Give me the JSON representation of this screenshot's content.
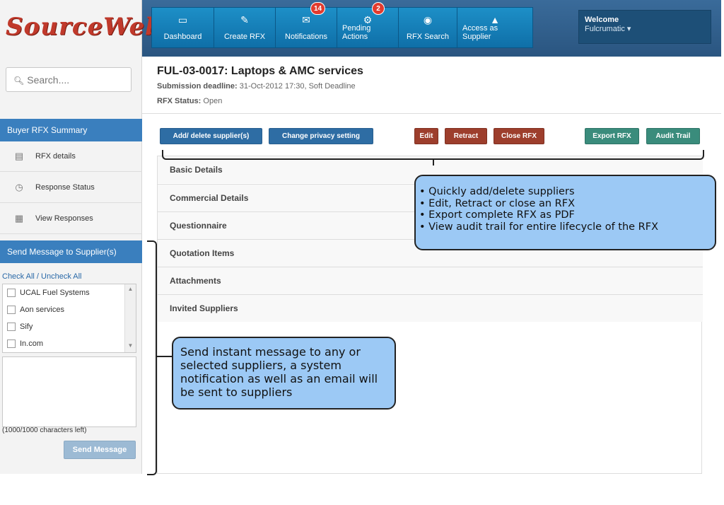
{
  "header": {
    "logo": "SourceWeb",
    "nav": [
      {
        "label": "Dashboard",
        "icon": "monitor-icon",
        "glyph": "▭"
      },
      {
        "label": "Create RFX",
        "icon": "edit-icon",
        "glyph": "✎"
      },
      {
        "label": "Notifications",
        "icon": "envelope-icon",
        "glyph": "✉",
        "badge": "14"
      },
      {
        "label": "Pending Actions",
        "icon": "gear-icon",
        "glyph": "⚙",
        "badge": "2"
      },
      {
        "label": "RFX Search",
        "icon": "search-circle-icon",
        "glyph": "◉"
      },
      {
        "label": "Access as Supplier",
        "icon": "supplier-icon",
        "glyph": "▲"
      }
    ],
    "welcome": "Welcome",
    "user": "Fulcrumatic ▾"
  },
  "sidebar": {
    "search_placeholder": "Search....",
    "summary_title": "Buyer RFX Summary",
    "items": [
      {
        "label": "RFX details",
        "icon": "list-icon"
      },
      {
        "label": "Response Status",
        "icon": "clock-icon"
      },
      {
        "label": "View Responses",
        "icon": "responses-icon"
      }
    ],
    "message_title": "Send Message to Supplier(s)",
    "check_all": "Check All / Uncheck All",
    "suppliers": [
      "UCAL Fuel Systems",
      "Aon services",
      "Sify",
      "In.com"
    ],
    "chars_left": "(1000/1000 characters left)",
    "send_button": "Send Message"
  },
  "main": {
    "title": "FUL-03-0017: Laptops & AMC services",
    "deadline_label": "Submission deadline:",
    "deadline_value": "31-Oct-2012 17:30, Soft Deadline",
    "status_label": "RFX Status:",
    "status_value": "Open",
    "buttons": {
      "add_delete": "Add/ delete supplier(s)",
      "privacy": "Change privacy setting",
      "edit": "Edit",
      "retract": "Retract",
      "close": "Close RFX",
      "export": "Export RFX",
      "audit": "Audit Trail"
    },
    "sections": [
      "Basic Details",
      "Commercial Details",
      "Questionnaire",
      "Quotation Items",
      "Attachments",
      "Invited Suppliers"
    ]
  },
  "annotations": {
    "callout_1": [
      "• Quickly add/delete suppliers",
      "• Edit, Retract or close an RFX",
      "• Export complete RFX as PDF",
      "• View audit trail for entire lifecycle of the RFX"
    ],
    "callout_2": "Send instant message to any or selected suppliers, a system notification as well as an email will be sent to suppliers"
  },
  "colors": {
    "header": "#2a5580",
    "nav": "#1d8fc7",
    "sidebar_section": "#3a7fbe",
    "button_blue": "#2e6da4",
    "button_red": "#9d3e2c",
    "button_teal": "#3a8c7c",
    "badge": "#e23b2e",
    "callout": "#9cc9f5",
    "logo": "#c0392b"
  }
}
